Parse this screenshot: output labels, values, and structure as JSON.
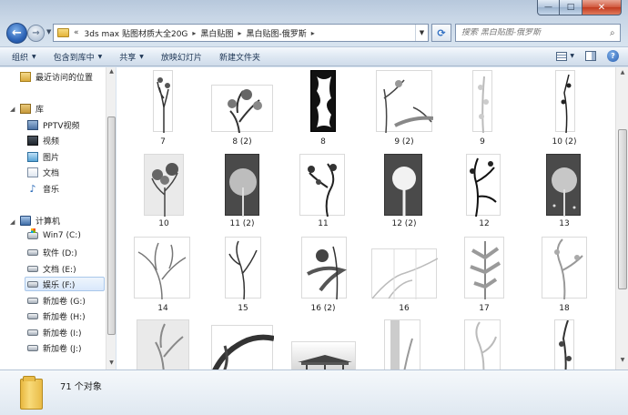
{
  "window": {
    "min_glyph": "—",
    "max_glyph": "□",
    "close_glyph": "✕"
  },
  "address": {
    "lead": "«",
    "crumbs": [
      "3ds max 贴图材质大全20G",
      "黑白贴图",
      "黑白贴图-俄罗斯"
    ],
    "sep": "▸"
  },
  "search": {
    "placeholder": "搜索 黑白贴图-俄罗斯"
  },
  "toolbar": {
    "organize": "组织",
    "include": "包含到库中",
    "share": "共享",
    "slideshow": "放映幻灯片",
    "new_folder": "新建文件夹"
  },
  "nav": {
    "recent": "最近访问的位置",
    "library": "库",
    "pptv": "PPTV视频",
    "video": "视频",
    "pictures": "图片",
    "documents": "文档",
    "music": "音乐",
    "computer": "计算机",
    "drives": [
      "Win7 (C:)",
      "软件 (D:)",
      "文档 (E:)",
      "娱乐 (F:)",
      "新加卷 (G:)",
      "新加卷 (H:)",
      "新加卷 (I:)",
      "新加卷 (J:)"
    ]
  },
  "files": {
    "row1": [
      "7",
      "8 (2)",
      "8",
      "9 (2)",
      "9",
      "10 (2)"
    ],
    "row2": [
      "10",
      "11 (2)",
      "11",
      "12 (2)",
      "12",
      "13"
    ],
    "row3": [
      "14",
      "15",
      "16 (2)",
      "16",
      "17",
      "18"
    ]
  },
  "status": {
    "count": "71 个对象"
  },
  "colors": {
    "accent": "#2d64b7",
    "folder": "#e9bb47",
    "close": "#c03a1f"
  }
}
